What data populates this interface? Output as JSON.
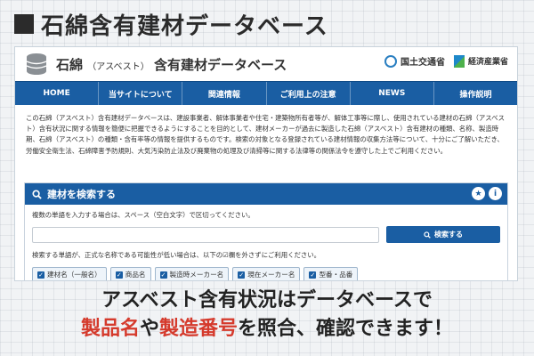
{
  "headline": {
    "text": "石綿含有建材データベース"
  },
  "site": {
    "title_main_1": "石綿",
    "title_small": "（アスベスト）",
    "title_main_2": "含有建材データベース",
    "ministry_1": "国土交通省",
    "ministry_2": "経済産業省"
  },
  "nav": {
    "home": "HOME",
    "about": "当サイトについて",
    "related": "関連情報",
    "notes": "ご利用上の注意",
    "news": "NEWS",
    "howto": "操作説明"
  },
  "description": "この石綿（アスベスト）含有建材データベースは、建設事業者、解体事業者や住宅・建築物所有者等が、解体工事等に際し、使用されている建材の石綿（アスベスト）含有状況に関する情報を簡便に把握できるようにすることを目的として、建材メーカーが過去に製造した石綿（アスベスト）含有建材の種類、名称、製造時期、石綿（アスベスト）の種類・含有率等の情報を提供するものです。検索の対象となる登録されている建材情報の収集方法等について、十分にご了解いただき、労働安全衛生法、石綿障害予防規則、大気汚染防止法及び廃棄物の処理及び清掃等に関する法律等の関係法令を遵守した上でご利用ください。",
  "search_panel": {
    "title": "建材を検索する",
    "hint": "複数の単語を入力する場合は、スペース（空白文字）で区切ってください。",
    "input_value": "",
    "button_label": "検索する",
    "note": "検索する単語が、正式な名称である可能性が低い場合は、以下の☑欄を外さずにご利用ください。",
    "checkboxes": [
      "建材名（一般名）",
      "商品名",
      "製造時メーカー名",
      "現在メーカー名",
      "型番・品番"
    ]
  },
  "caption": {
    "line1": "アスベスト含有状況はデータベースで",
    "line2_a": "製品名",
    "line2_b": "や",
    "line2_c": "製造番号",
    "line2_d": "を照合、確認できます！"
  }
}
